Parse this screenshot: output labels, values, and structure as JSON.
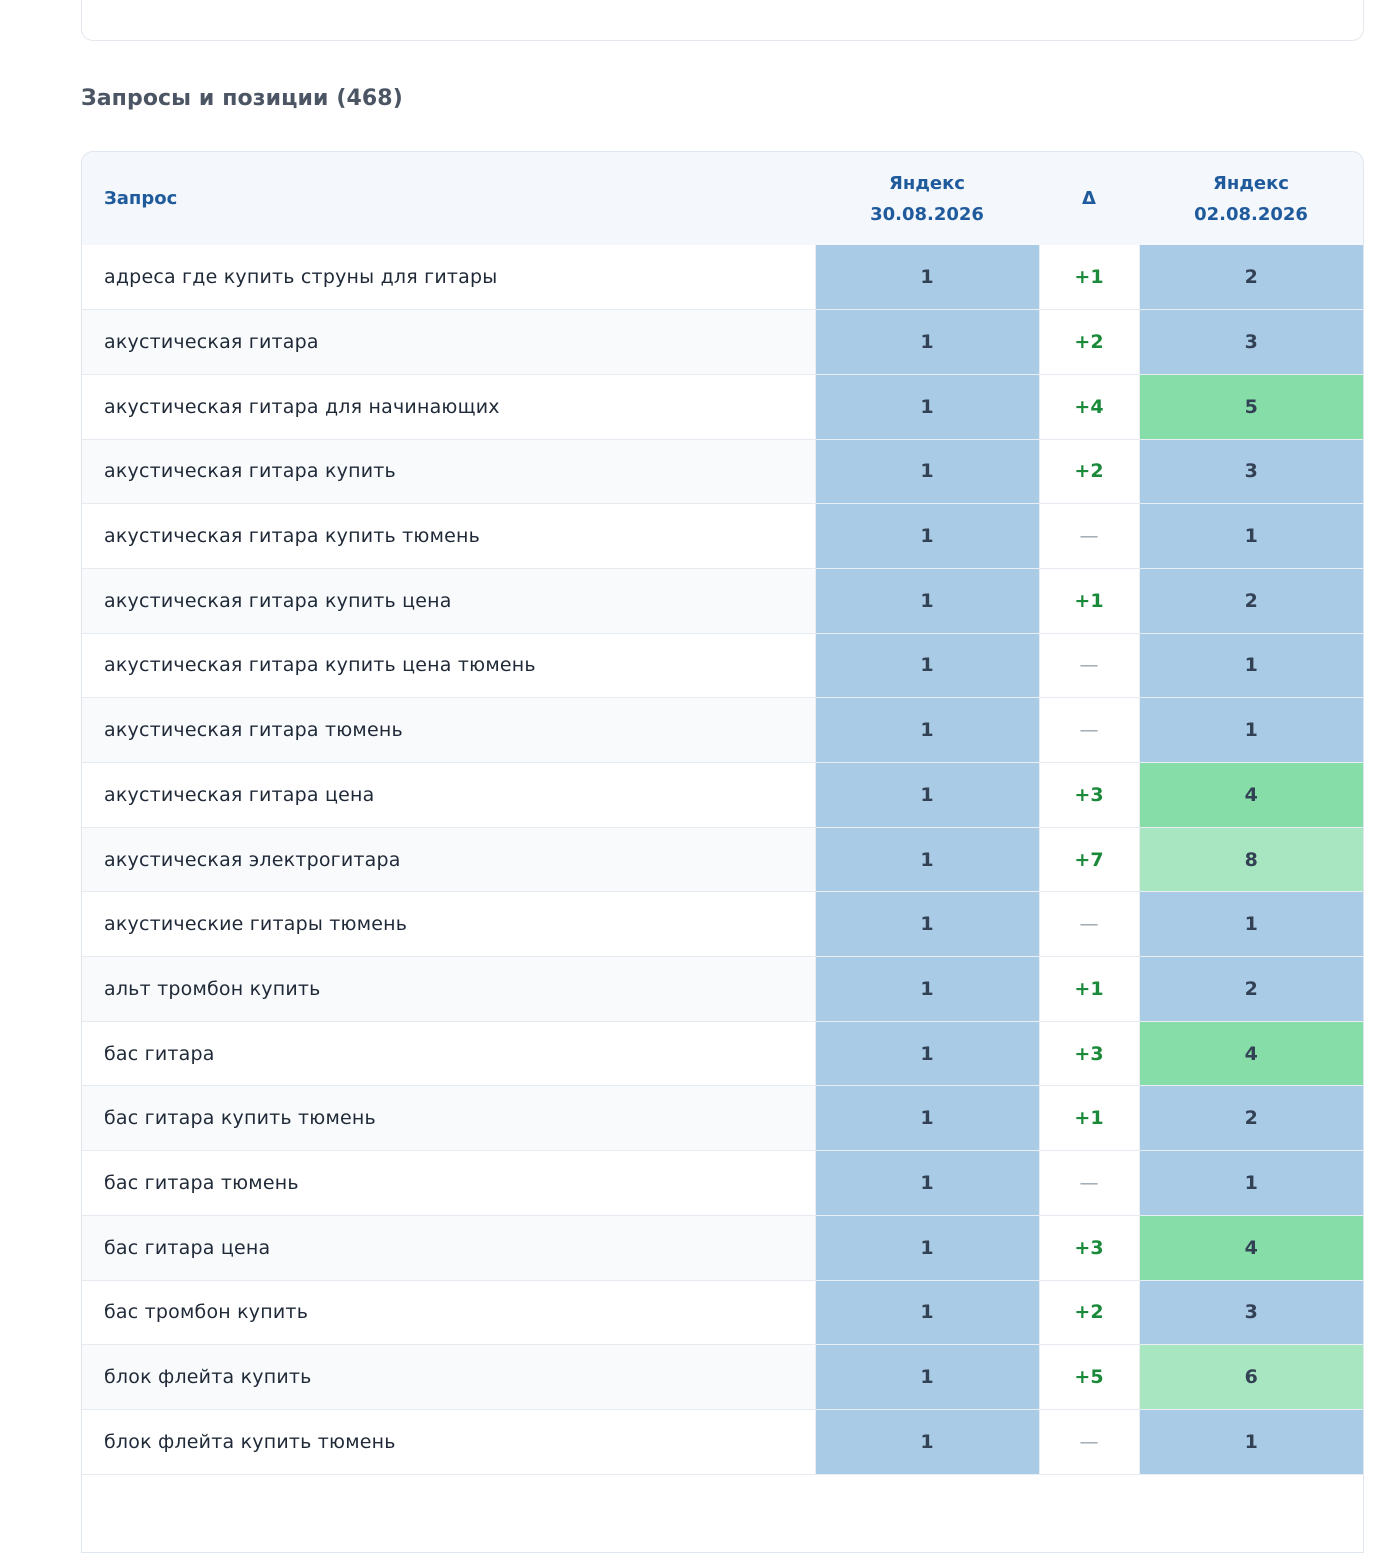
{
  "section": {
    "title": "Запросы и позиции (468)"
  },
  "colors": {
    "pos_top3": "#a9cbe5",
    "pos_4_5": "#86dda8",
    "pos_6_10": "#a8e6c1",
    "delta_up": "#1a8a3a",
    "header_text": "#1f5b9c"
  },
  "table": {
    "headers": {
      "query": "Запрос",
      "engine_current": "Яндекс",
      "date_current": "30.08.2026",
      "delta": "Δ",
      "engine_previous": "Яндекс",
      "date_previous": "02.08.2026"
    },
    "rows": [
      {
        "query": "адреса где купить струны для гитары",
        "current": 1,
        "delta": "+1",
        "previous": 2
      },
      {
        "query": "акустическая гитара",
        "current": 1,
        "delta": "+2",
        "previous": 3
      },
      {
        "query": "акустическая гитара для начинающих",
        "current": 1,
        "delta": "+4",
        "previous": 5
      },
      {
        "query": "акустическая гитара купить",
        "current": 1,
        "delta": "+2",
        "previous": 3
      },
      {
        "query": "акустическая гитара купить тюмень",
        "current": 1,
        "delta": "—",
        "previous": 1
      },
      {
        "query": "акустическая гитара купить цена",
        "current": 1,
        "delta": "+1",
        "previous": 2
      },
      {
        "query": "акустическая гитара купить цена тюмень",
        "current": 1,
        "delta": "—",
        "previous": 1
      },
      {
        "query": "акустическая гитара тюмень",
        "current": 1,
        "delta": "—",
        "previous": 1
      },
      {
        "query": "акустическая гитара цена",
        "current": 1,
        "delta": "+3",
        "previous": 4
      },
      {
        "query": "акустическая электрогитара",
        "current": 1,
        "delta": "+7",
        "previous": 8
      },
      {
        "query": "акустические гитары тюмень",
        "current": 1,
        "delta": "—",
        "previous": 1
      },
      {
        "query": "альт тромбон купить",
        "current": 1,
        "delta": "+1",
        "previous": 2
      },
      {
        "query": "бас гитара",
        "current": 1,
        "delta": "+3",
        "previous": 4
      },
      {
        "query": "бас гитара купить тюмень",
        "current": 1,
        "delta": "+1",
        "previous": 2
      },
      {
        "query": "бас гитара тюмень",
        "current": 1,
        "delta": "—",
        "previous": 1
      },
      {
        "query": "бас гитара цена",
        "current": 1,
        "delta": "+3",
        "previous": 4
      },
      {
        "query": "бас тромбон купить",
        "current": 1,
        "delta": "+2",
        "previous": 3
      },
      {
        "query": "блок флейта купить",
        "current": 1,
        "delta": "+5",
        "previous": 6
      },
      {
        "query": "блок флейта купить тюмень",
        "current": 1,
        "delta": "—",
        "previous": 1
      }
    ]
  }
}
